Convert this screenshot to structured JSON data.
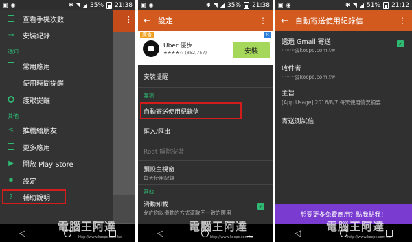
{
  "panel1": {
    "status": {
      "battery": "35%",
      "time": "21:38"
    },
    "drawer": {
      "top_items": [
        {
          "label": "查看手機次數",
          "icon": "phone-count-icon"
        },
        {
          "label": "安裝紀錄",
          "icon": "install-log-icon"
        }
      ],
      "section_notify": "通知",
      "notify_items": [
        {
          "label": "常用應用",
          "icon": "apps-grid-icon"
        },
        {
          "label": "使用時間提醒",
          "icon": "timer-icon"
        },
        {
          "label": "護眼提醒",
          "icon": "eye-care-icon"
        }
      ],
      "section_other": "其他",
      "other_items": [
        {
          "label": "推薦給朋友",
          "icon": "share-icon"
        },
        {
          "label": "更多應用",
          "icon": "more-apps-icon"
        },
        {
          "label": "開放 Play Store",
          "icon": "play-store-icon"
        },
        {
          "label": "設定",
          "icon": "gear-icon"
        },
        {
          "label": "輔助說明",
          "icon": "help-icon"
        }
      ]
    }
  },
  "panel2": {
    "status": {
      "battery": "35%",
      "time": "21:38"
    },
    "toolbar": {
      "title": "設定"
    },
    "ad": {
      "tag": "廣告",
      "name": "Uber 優步",
      "rating": "★★★★☆ (862,757)",
      "install": "安裝"
    },
    "items": {
      "install_alert": "安裝提醒",
      "section_items": "雜項",
      "auto_send": "自動寄送使用紀錄信",
      "import_export": "匯入/匯出",
      "root_uninstall": "Root 解除安裝",
      "default_view_title": "預設主視窗",
      "default_view_sub": "每天使用紀錄",
      "section_other": "其他",
      "swipe_title": "滑動卸載",
      "swipe_sub": "允許你以滑動的方式還款不一致的應用"
    }
  },
  "panel3": {
    "status": {
      "battery": "51%",
      "time": "21:12"
    },
    "toolbar": {
      "title": "自動寄送使用紀錄信"
    },
    "rows": {
      "gmail_title": "透過 Gmail 寄送",
      "gmail_sub": "········@kocpc.com.tw",
      "recipient_title": "收件者",
      "recipient_sub": "········@kocpc.com.tw",
      "subject_title": "主旨",
      "subject_sub": "[App Usage] 2016/8/7 每天使用情況摘要",
      "test_title": "寄送測試信"
    },
    "banner": "想要更多免費應用？點我點我！"
  },
  "watermark": {
    "text": "電腦王阿達",
    "url": "http://www.kocpc.com.tw"
  },
  "colors": {
    "accent": "#d35a1f",
    "green": "#2eb872",
    "highlight": "#d31c1c",
    "banner": "#7a3bd1"
  }
}
